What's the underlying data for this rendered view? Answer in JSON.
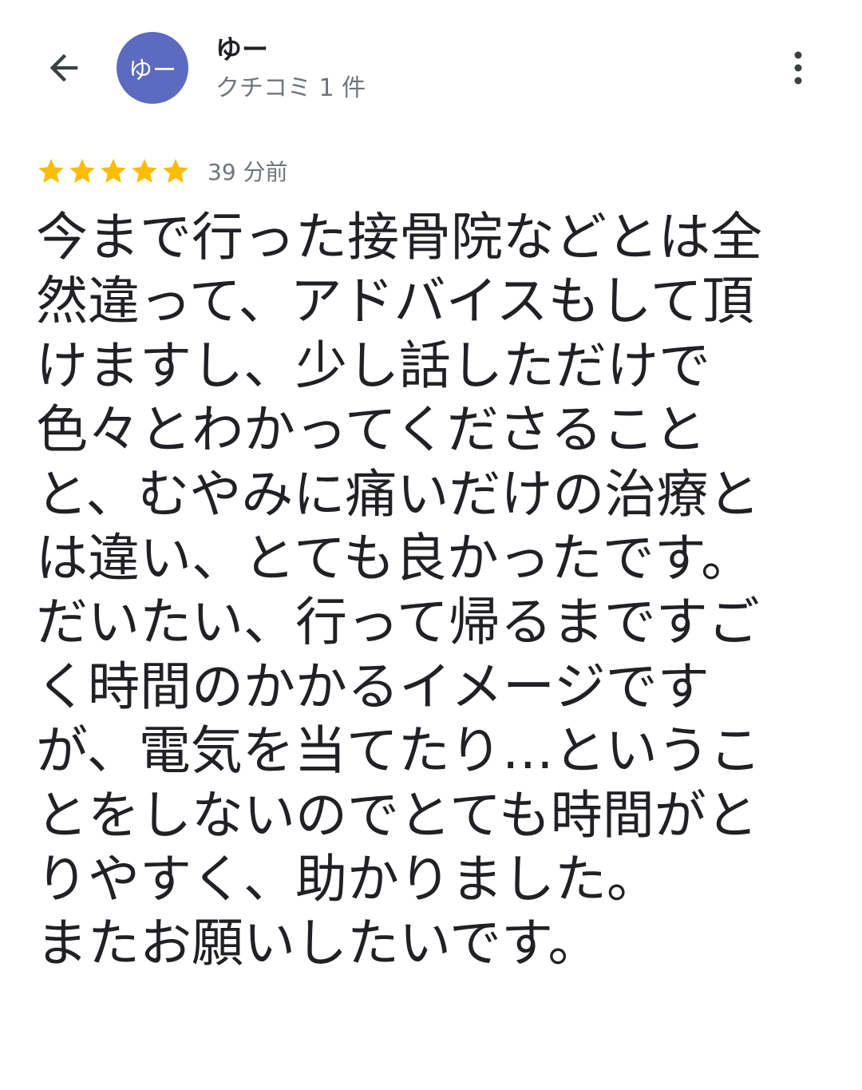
{
  "header": {
    "avatar_text": "ゆー",
    "avatar_color": "#5c6bc0",
    "user_name": "ゆー",
    "review_count": "クチコミ 1 件"
  },
  "review": {
    "star_color": "#fbbc04",
    "stars": 5,
    "time_ago": "39 分前",
    "lines": [
      "今まで行った接骨院などとは全",
      "然違って、アドバイスもして頂",
      "けますし、少し話しただけで",
      "色々とわかってくださること",
      "と、むやみに痛いだけの治療と",
      "は違い、とても良かったです。",
      "だいたい、行って帰るまですご",
      "く時間のかかるイメージです",
      "が、電気を当てたり…というこ",
      "とをしないのでとても時間がと",
      "りやすく、助かりました。",
      "またお願いしたいです。"
    ]
  }
}
